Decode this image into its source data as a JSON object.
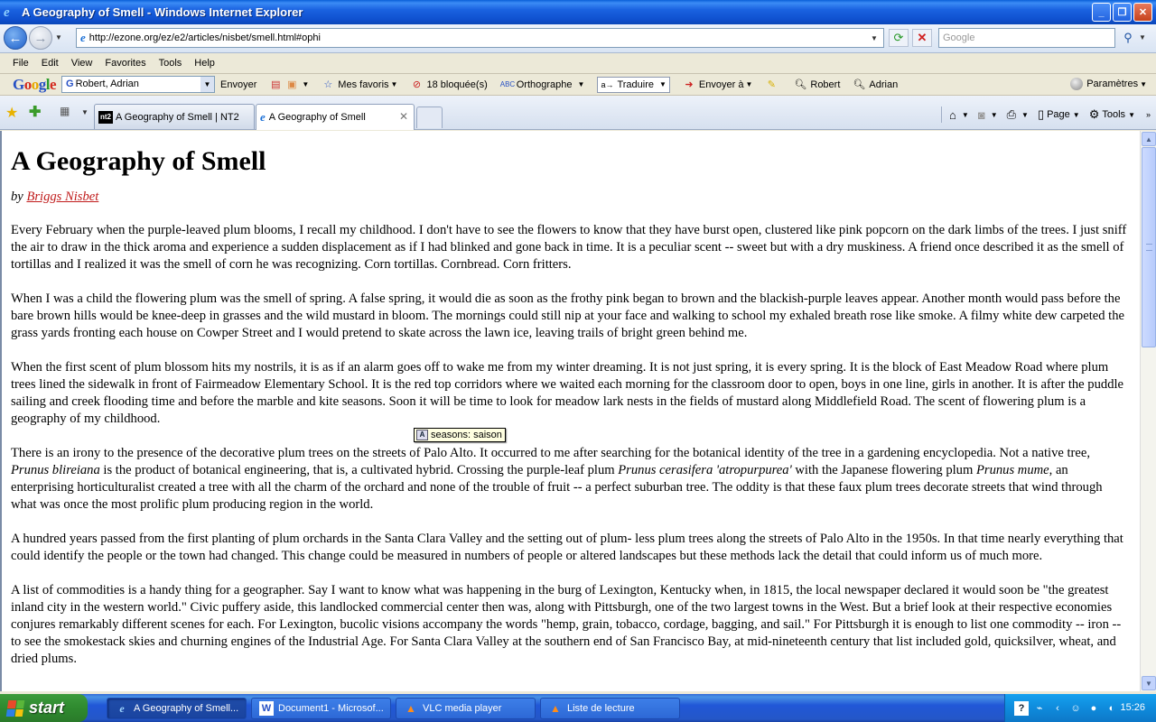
{
  "window": {
    "title": "A Geography of Smell - Windows Internet Explorer"
  },
  "address_bar": {
    "url": "http://ezone.org/ez/e2/articles/nisbet/smell.html#ophi",
    "search_placeholder": "Google"
  },
  "menu": {
    "items": [
      "File",
      "Edit",
      "View",
      "Favorites",
      "Tools",
      "Help"
    ]
  },
  "google_toolbar": {
    "logo": [
      "G",
      "o",
      "o",
      "g",
      "l",
      "e"
    ],
    "search_value": "Robert, Adrian",
    "envoyer": "Envoyer",
    "favoris": "Mes favoris",
    "blocked": "18 bloquée(s)",
    "spell": "Orthographe",
    "translate": "Traduire",
    "send_to": "Envoyer à",
    "name1": "Robert",
    "name2": "Adrian",
    "settings": "Paramètres"
  },
  "tabs": [
    {
      "label": "A Geography of Smell | NT2",
      "favicon": "nt2"
    },
    {
      "label": "A Geography of Smell",
      "favicon": "ie"
    }
  ],
  "command_bar": {
    "page": "Page",
    "tools": "Tools"
  },
  "article": {
    "title": "A Geography of Smell",
    "by": "by",
    "author": "Briggs Nisbet",
    "paragraphs": [
      "Every February when the purple-leaved plum blooms, I recall my childhood. I don't have to see the flowers to know that they have burst open, clustered like pink popcorn on the dark limbs of the trees. I just sniff the air to draw in the thick aroma and experience a sudden displacement as if I had blinked and gone back in time. It is a peculiar scent -- sweet but with a dry muskiness. A friend once described it as the smell of tortillas and I realized it was the smell of corn he was recognizing. Corn tortillas. Cornbread. Corn fritters.",
      "When I was a child the flowering plum was the smell of spring. A false spring, it would die as soon as the frothy pink began to brown and the blackish-purple leaves appear. Another month would pass before the bare brown hills would be knee-deep in grasses and the wild mustard in bloom. The mornings could still nip at your face and walking to school my exhaled breath rose like smoke. A filmy white dew carpeted the grass yards fronting each house on Cowper Street and I would pretend to skate across the lawn ice, leaving trails of bright green behind me.",
      "When the first scent of plum blossom hits my nostrils, it is as if an alarm goes off to wake me from my winter dreaming. It is not just spring, it is every spring. It is the block of East Meadow Road where plum trees lined the sidewalk in front of Fairmeadow Elementary School. It is the red top corridors where we waited each morning for the classroom door to open, boys in one line, girls in another. It is after the puddle sailing and creek flooding time and before the marble and kite seasons. Soon it will be time to look for meadow lark nests in the fields of mustard along Middlefield Road. The scent of flowering plum is a geography of my childhood."
    ],
    "p4": {
      "a": "There is an irony to the presence of the decorative plum trees on the streets of Palo Alto. It occurred to me after searching for the botanical identity of the tree in a gardening encyclopedia. Not a native tree, ",
      "i1": "Prunus blireiana",
      "b": " is the product of botanical engineering, that is, a cultivated hybrid. Crossing the purple-leaf plum ",
      "i2": "Prunus cerasifera 'atropurpurea'",
      "c": " with the Japanese flowering plum ",
      "i3": "Prunus mume",
      "d": ", an enterprising horticulturalist created a tree with all the charm of the orchard and none of the trouble of fruit -- a perfect suburban tree. The oddity is that these faux plum trees decorate streets that wind through what was once the most prolific plum producing region in the world."
    },
    "p5": "A hundred years passed from the first planting of plum orchards in the Santa Clara Valley and the setting out of plum- less plum trees along the streets of Palo Alto in the 1950s. In that time nearly everything that could identify the people or the town had changed. This change could be measured in numbers of people or altered landscapes but these methods lack the detail that could inform us of much more.",
    "p6": "A list of commodities is a handy thing for a geographer. Say I want to know what was happening in the burg of Lexington, Kentucky when, in 1815, the local newspaper declared it would soon be \"the greatest inland city in the western world.\" Civic puffery aside, this landlocked commercial center then was, along with Pittsburgh, one of the two largest towns in the West. But a brief look at their respective economies conjures remarkably different scenes for each. For Lexington, bucolic visions accompany the words \"hemp, grain, tobacco, cordage, bagging, and sail.\" For Pittsburgh it is enough to list one commodity -- iron -- to see the smokestack skies and churning engines of the Industrial Age. For Santa Clara Valley at the southern end of San Francisco Bay, at mid-nineteenth century that list included gold, quicksilver, wheat, and dried plums."
  },
  "tooltip": {
    "text": "seasons: saison"
  },
  "taskbar": {
    "start": "start",
    "tasks": [
      {
        "label": "A Geography of Smell...",
        "icon": "ie-icon"
      },
      {
        "label": "Document1 - Microsof...",
        "icon": "word-icon"
      },
      {
        "label": "VLC media player",
        "icon": "vlc-icon"
      },
      {
        "label": "Liste de lecture",
        "icon": "vlc-icon"
      }
    ],
    "clock": "15:26"
  }
}
